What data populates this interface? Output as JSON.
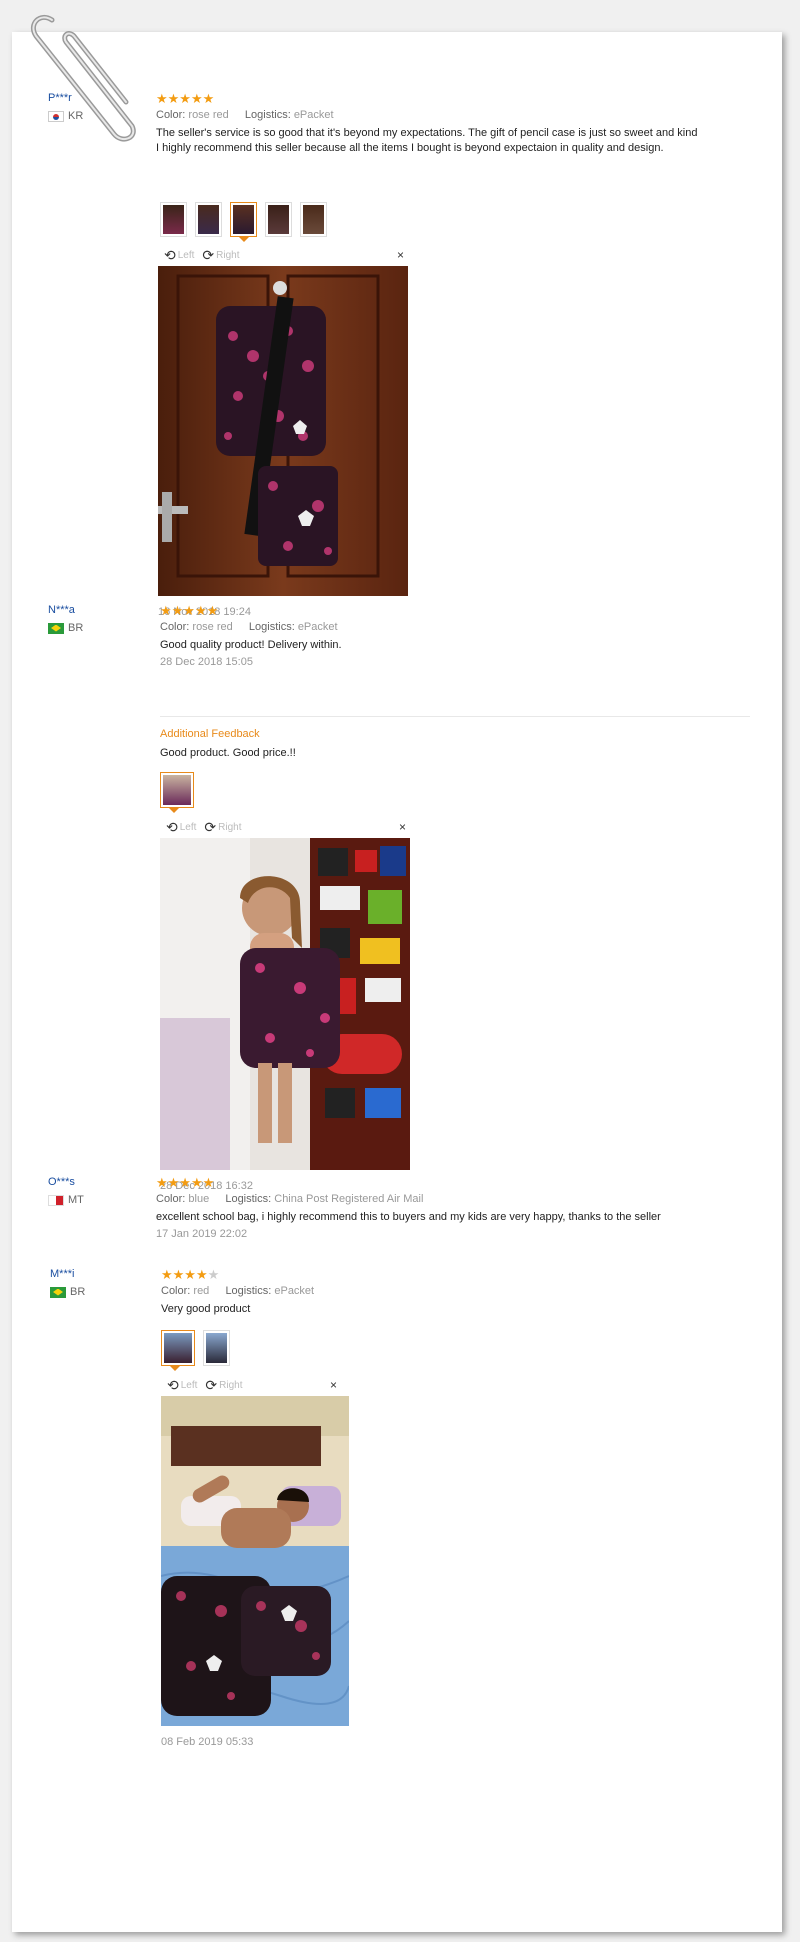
{
  "reviews": [
    {
      "user": "P***r",
      "country": "KR",
      "rating": 5,
      "color_label": "Color:",
      "color": "rose red",
      "logistics_label": "Logistics:",
      "logistics": "ePacket",
      "text_line1": "The seller's service is so good that it's beyond my expectations. The gift of pencil case is just so sweet and kind",
      "text_line2": "I highly recommend this seller because all the items I bought is beyond expectaion in quality and design.",
      "date": "16 Nov 2018 19:24"
    },
    {
      "user": "N***a",
      "country": "BR",
      "rating": 5,
      "color_label": "Color:",
      "color": "rose red",
      "logistics_label": "Logistics:",
      "logistics": "ePacket",
      "text": "Good quality product! Delivery within.",
      "date": "28 Dec 2018 15:05",
      "additional_label": "Additional Feedback",
      "additional_text": "Good product. Good price.!!",
      "additional_date": "28 Dec 2018 16:32"
    },
    {
      "user": "O***s",
      "country": "MT",
      "rating": 5,
      "color_label": "Color:",
      "color": "blue",
      "logistics_label": "Logistics:",
      "logistics": "China Post Registered Air Mail",
      "text": "excellent school bag, i highly recommend this to buyers and my kids are very happy, thanks to the seller",
      "date": "17 Jan 2019 22:02"
    },
    {
      "user": "M***i",
      "country": "BR",
      "rating": 4,
      "color_label": "Color:",
      "color": "red",
      "logistics_label": "Logistics:",
      "logistics": "ePacket",
      "text": "Very good product",
      "date": "08 Feb 2019 05:33"
    }
  ],
  "viewer": {
    "left_label": "Left",
    "right_label": "Right",
    "close_icon": "×"
  },
  "stars": {
    "full": "★★★★★",
    "four": "★★★★",
    "empty_one": "★"
  },
  "colors": {
    "star": "#f39c12",
    "accent": "#e88a1a",
    "username": "#1a4ea0"
  }
}
